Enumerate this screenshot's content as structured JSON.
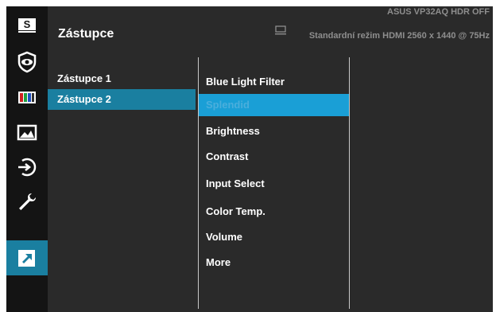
{
  "header": {
    "title": "Zástupce",
    "model_info": "ASUS  VP32AQ  HDR OFF",
    "status_line": "Standardní režim HDMI 2560 x 1440 @ 75Hz"
  },
  "sidebar": {
    "items": [
      {
        "icon": "splendid-s-icon",
        "active": false
      },
      {
        "icon": "eye-care-icon",
        "active": false
      },
      {
        "icon": "color-bars-icon",
        "active": false
      },
      {
        "icon": "image-icon",
        "active": false
      },
      {
        "icon": "input-select-icon",
        "active": false
      },
      {
        "icon": "wrench-icon",
        "active": false
      },
      {
        "icon": "shortcut-arrow-icon",
        "active": true
      }
    ]
  },
  "submenu": {
    "items": [
      {
        "label": "Zástupce 1",
        "active": false
      },
      {
        "label": "Zástupce 2",
        "active": true
      }
    ]
  },
  "options": {
    "items": [
      {
        "label": "Blue Light Filter",
        "active": false
      },
      {
        "label": "Splendid",
        "active": true
      },
      {
        "label": "Brightness",
        "active": false
      },
      {
        "label": "Contrast",
        "active": false
      },
      {
        "label": "Input Select",
        "active": false
      },
      {
        "label": "Color Temp.",
        "active": false
      },
      {
        "label": "Volume",
        "active": false
      },
      {
        "label": "More",
        "active": false
      }
    ]
  },
  "colors": {
    "accent": "#1a7fa0",
    "highlight": "#1a9fd6",
    "background": "#2a2a2a"
  }
}
